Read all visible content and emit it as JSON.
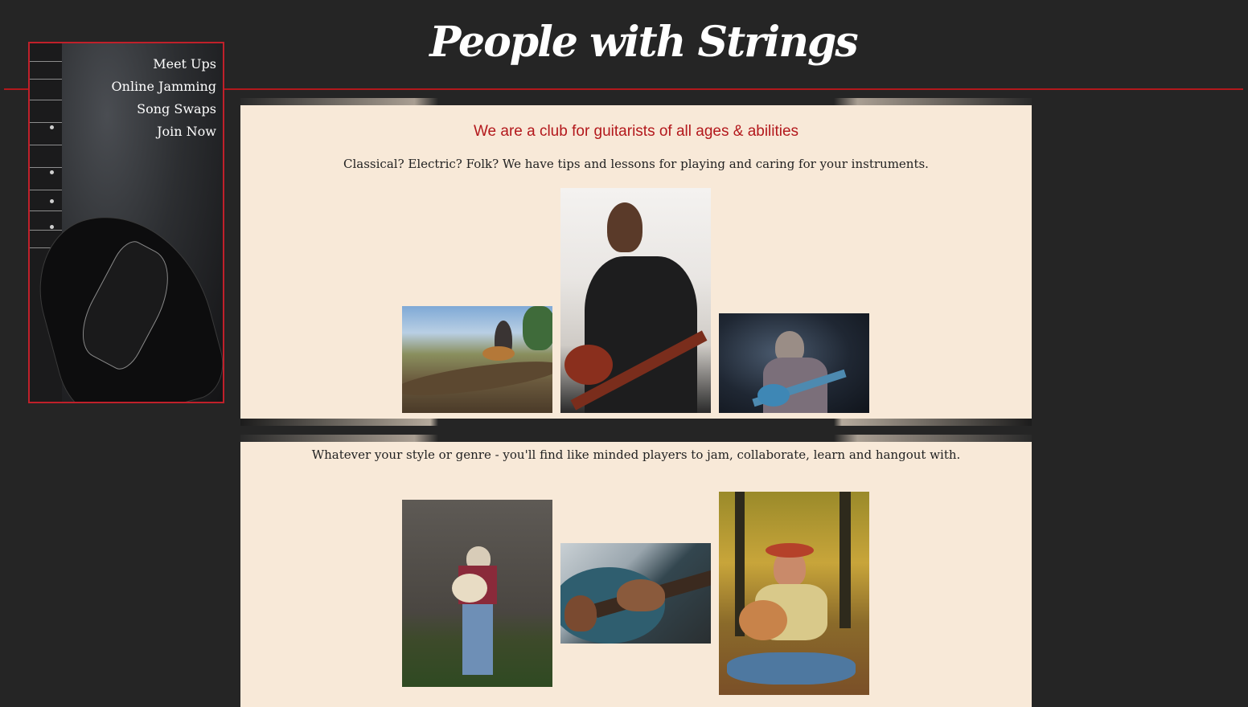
{
  "site": {
    "title": "People with Strings"
  },
  "nav": {
    "items": [
      {
        "label": "Meet Ups"
      },
      {
        "label": "Online Jamming"
      },
      {
        "label": "Song Swaps"
      },
      {
        "label": "Join Now"
      }
    ]
  },
  "intro": {
    "heading": "We are a club for guitarists of all ages & abilities",
    "text": "Classical? Electric? Folk? We have tips and lessons for playing and caring for your instruments."
  },
  "community": {
    "text": "Whatever your style or genre - you'll find like minded players to jam, collaborate, learn and hangout with."
  },
  "colors": {
    "background": "#252525",
    "accent": "#b3181c",
    "panel": "#f8e9d8"
  },
  "images": {
    "sidebar": "electric-guitar-photo",
    "row1": [
      "guitarist-on-palm-trunk-photo",
      "bassist-man-bun-photo",
      "singer-stage-bass-photo"
    ],
    "row2": [
      "cowboy-acoustic-barn-photo",
      "hands-fretting-guitar-photo",
      "woman-autumn-forest-guitar-photo"
    ]
  }
}
